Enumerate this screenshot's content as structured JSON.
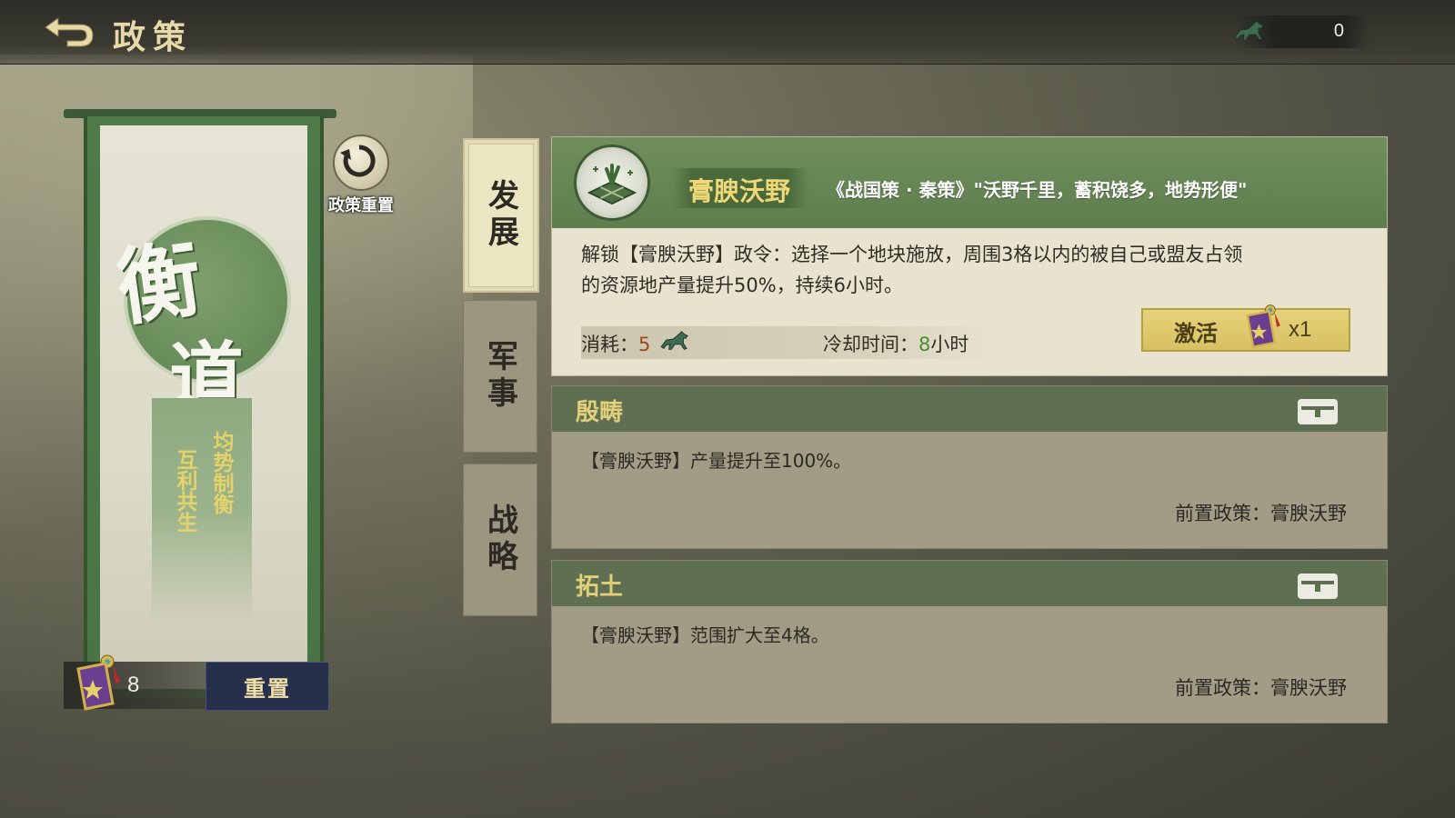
{
  "header": {
    "title": "政策",
    "resource_count": "0"
  },
  "banner": {
    "char1": "衡",
    "char2": "道",
    "motto_right": "均势制衡",
    "motto_left": "互利共生",
    "token_count": "8",
    "reset_label": "重置",
    "policy_reset_label": "政策重置"
  },
  "tabs": [
    {
      "label": "发展",
      "active": true
    },
    {
      "label": "军事",
      "active": false
    },
    {
      "label": "战略",
      "active": false
    }
  ],
  "main_policy": {
    "name": "膏腴沃野",
    "quote": "《战国策 · 秦策》\"沃野千里，蓄积饶多，地势形便\"",
    "desc_line1": "解锁【膏腴沃野】政令：选择一个地块施放，周围3格以内的被自己或盟友占领",
    "desc_line2": "的资源地产量提升50%，持续6小时。",
    "cost_label": "消耗：",
    "cost_value": "5",
    "cd_label": "冷却时间：",
    "cd_value": "8",
    "cd_unit": "小时",
    "activate_label": "激活",
    "activate_count": "x1"
  },
  "locked_policies": [
    {
      "name": "殷畴",
      "desc": "【膏腴沃野】产量提升至100%。",
      "prereq": "前置政策：膏腴沃野"
    },
    {
      "name": "拓土",
      "desc": "【膏腴沃野】范围扩大至4格。",
      "prereq": "前置政策：膏腴沃野"
    }
  ],
  "colors": {
    "accent_green": "#5e7e4d",
    "gold": "#e2cf7a",
    "button_blue": "#26304a"
  },
  "icons": [
    "back-arrow-icon",
    "horse-icon",
    "token-icon",
    "reset-icon",
    "farmland-icon",
    "lock-icon"
  ]
}
